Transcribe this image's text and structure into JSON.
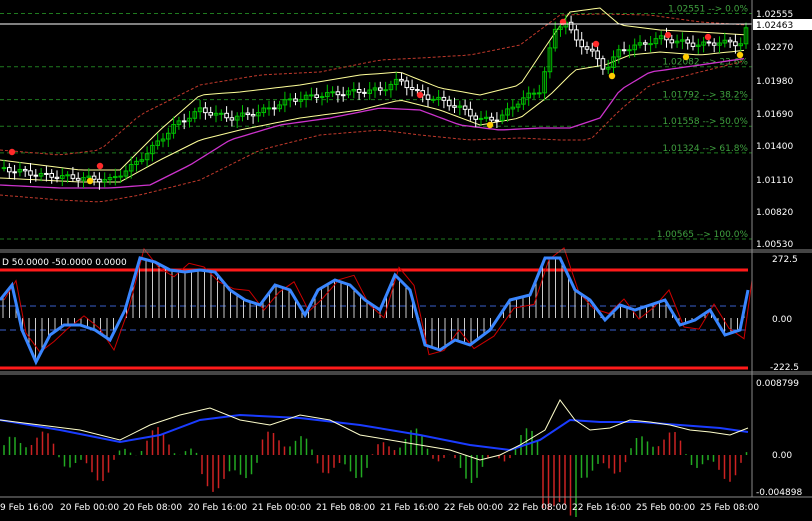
{
  "colors": {
    "background": "#000000",
    "separator": "#8a8a8a",
    "bull_candle": "#00c000",
    "bear_candle": "#ffffff",
    "fib_level": "#1f7a1f",
    "fib_text": "#3fa03f",
    "band_outer": "#c0392b",
    "band_inner": "#ffff99",
    "ma_magenta": "#cc33cc",
    "osc_main": "#3a86ff",
    "osc_signal": "#cc0000",
    "osc_level_line": "#ff1a1a",
    "osc_dash": "#3a5fcd",
    "macd_white": "#ffffcc",
    "macd_blue": "#1a3cff",
    "hist_up": "#22aa22",
    "hist_down": "#cc2222"
  },
  "main": {
    "current_price": "1.02463",
    "price_axis": [
      "1.02555",
      "1.02270",
      "1.01980",
      "1.01690",
      "1.01400",
      "1.01110",
      "1.00820",
      "1.00530"
    ],
    "fib_levels": [
      {
        "label": "1.02551 --> 0.0%",
        "price": 1.02551
      },
      {
        "label": "1.02082 --> 23.6%",
        "price": 1.02082
      },
      {
        "label": "1.01792 --> 38.2%",
        "price": 1.01792
      },
      {
        "label": "1.01558 --> 50.0%",
        "price": 1.01558
      },
      {
        "label": "1.01324 --> 61.8%",
        "price": 1.01324
      },
      {
        "label": "1.00565 --> 100.0%",
        "price": 1.00565
      }
    ]
  },
  "oscillator": {
    "header": "D 50.0000 -50.0000 0.0000",
    "axis": [
      "272.5",
      "0.00",
      "-222.5"
    ]
  },
  "macd": {
    "axis": [
      "0.008799",
      "0.00",
      "-0.004898"
    ]
  },
  "time_axis": [
    "9 Feb 16:00",
    "20 Feb 00:00",
    "20 Feb 08:00",
    "20 Feb 16:00",
    "21 Feb 00:00",
    "21 Feb 08:00",
    "21 Feb 16:00",
    "22 Feb 00:00",
    "22 Feb 08:00",
    "22 Feb 16:00",
    "25 Feb 00:00",
    "25 Feb 08:00"
  ]
}
